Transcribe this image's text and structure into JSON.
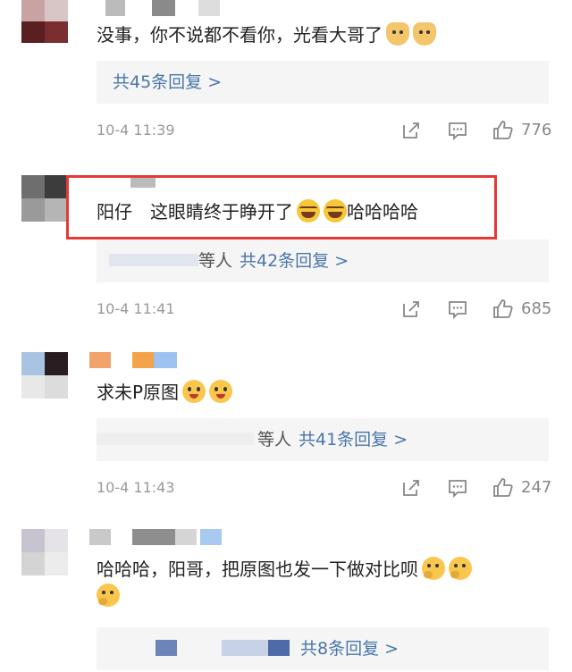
{
  "comments": [
    {
      "text": "没事，你不说都不看你，光看大哥了",
      "emojis": [
        "doge-icon",
        "doge-icon"
      ],
      "reply": {
        "prefix": "",
        "label": "共45条回复 >"
      },
      "time": "10-4 11:39",
      "likes": "776"
    },
    {
      "text": "阳仔　这眼睛终于睁开了",
      "emojis": [
        "laugh-cry-icon",
        "laugh-cry-icon"
      ],
      "suffix": "哈哈哈哈",
      "reply": {
        "prefix": "等人",
        "label": "共42条回复 >"
      },
      "time": "10-4 11:41",
      "likes": "685"
    },
    {
      "text": "求未P原图",
      "emojis": [
        "drool-icon",
        "drool-icon"
      ],
      "reply": {
        "prefix": "等人",
        "label": "共41条回复 >"
      },
      "time": "10-4 11:43",
      "likes": "247"
    },
    {
      "text": "哈哈哈，阳哥，把原图也发一下做对比呗",
      "emojis": [
        "thinking-icon",
        "thinking-icon",
        "thinking-icon"
      ],
      "reply": {
        "prefix": "",
        "label": "共8条回复 >"
      }
    }
  ],
  "colors": {
    "link": "#4a76a8",
    "meta": "#999999",
    "highlight": "#e53935",
    "reply_bg": "#f5f5f5"
  }
}
